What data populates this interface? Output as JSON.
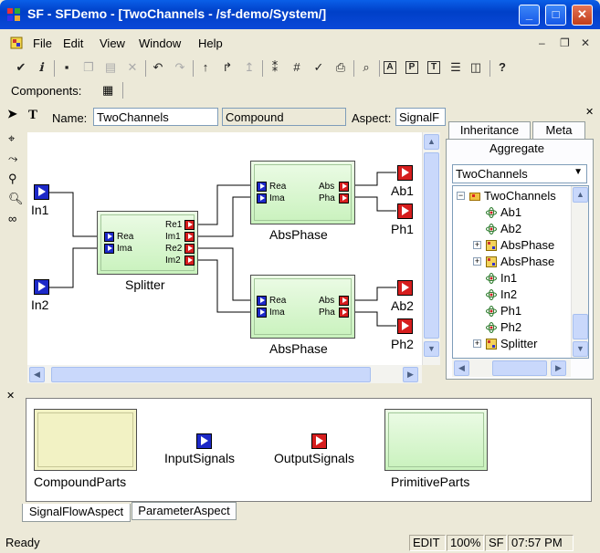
{
  "window": {
    "title": "SF - SFDemo - [TwoChannels - /sf-demo/System/]",
    "min_label": "_",
    "max_label": "□",
    "close_label": "✕",
    "mdi_min": "–",
    "mdi_restore": "❐",
    "mdi_close": "✕"
  },
  "menu": [
    "File",
    "Edit",
    "View",
    "Window",
    "Help"
  ],
  "components_label": "Components:",
  "toolbar_icons": [
    "check-icon",
    "info-icon",
    "save-icon",
    "copy-icon",
    "paste-icon",
    "delete-icon",
    "undo-icon",
    "redo-icon",
    "arrow-up-icon",
    "arrow-up-right-icon",
    "arrow-up-thin-icon",
    "connect-icon",
    "grid-icon",
    "check-mark-icon",
    "print-icon",
    "find-icon",
    "annotation-a-icon",
    "annotation-p-icon",
    "annotation-t-icon",
    "layout-icon",
    "panel-icon",
    "help-icon"
  ],
  "name_row": {
    "name_label": "Name:",
    "name_value": "TwoChannels",
    "kind_value": "Compound",
    "aspect_label": "Aspect:",
    "aspect_value": "SignalF"
  },
  "diagram": {
    "inputs": [
      "In1",
      "In2"
    ],
    "outputs": [
      "Ab1",
      "Ph1",
      "Ab2",
      "Ph2"
    ],
    "splitter": {
      "name": "Splitter",
      "in_ports": [
        "Rea",
        "Ima"
      ],
      "out_ports": [
        "Re1",
        "Im1",
        "Re2",
        "Im2"
      ]
    },
    "absphase_top": {
      "name": "AbsPhase",
      "in_ports": [
        "Rea",
        "Ima"
      ],
      "out_ports": [
        "Abs",
        "Pha"
      ]
    },
    "absphase_bottom": {
      "name": "AbsPhase",
      "in_ports": [
        "Rea",
        "Ima"
      ],
      "out_ports": [
        "Abs",
        "Pha"
      ]
    }
  },
  "right_panel": {
    "tabs": [
      "Inheritance",
      "Meta"
    ],
    "active_tab": "Aggregate",
    "dropdown_value": "TwoChannels",
    "tree": [
      {
        "label": "TwoChannels",
        "icon": "folder-icon",
        "expander": "−",
        "level": 0
      },
      {
        "label": "Ab1",
        "icon": "atom-icon",
        "expander": "",
        "level": 1
      },
      {
        "label": "Ab2",
        "icon": "atom-icon",
        "expander": "",
        "level": 1
      },
      {
        "label": "AbsPhase",
        "icon": "model-icon",
        "expander": "+",
        "level": 1
      },
      {
        "label": "AbsPhase",
        "icon": "model-icon",
        "expander": "+",
        "level": 1
      },
      {
        "label": "In1",
        "icon": "atom-icon",
        "expander": "",
        "level": 1
      },
      {
        "label": "In2",
        "icon": "atom-icon",
        "expander": "",
        "level": 1
      },
      {
        "label": "Ph1",
        "icon": "atom-icon",
        "expander": "",
        "level": 1
      },
      {
        "label": "Ph2",
        "icon": "atom-icon",
        "expander": "",
        "level": 1
      },
      {
        "label": "Splitter",
        "icon": "model-icon",
        "expander": "+",
        "level": 1
      }
    ]
  },
  "parts_browser": {
    "items": [
      "CompoundParts",
      "InputSignals",
      "OutputSignals",
      "PrimitiveParts"
    ],
    "tabs": [
      "SignalFlowAspect",
      "ParameterAspect"
    ]
  },
  "status": {
    "text": "Ready",
    "mode": "EDIT",
    "zoom": "100%",
    "paradigm": "SF",
    "time": "07:57 PM"
  },
  "colors": {
    "input_port": "#1d29c8",
    "output_port": "#d61e1e",
    "block_fill": "#c9f2bd",
    "compound_fill": "#f2f2c4"
  }
}
